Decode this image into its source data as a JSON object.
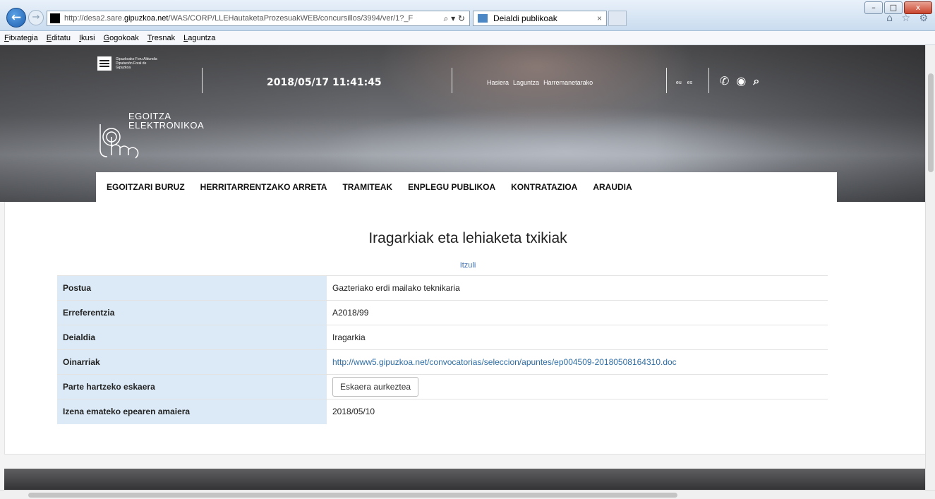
{
  "browser": {
    "url_prefix": "http://desa2.sare.",
    "url_domain": "gipuzkoa.net",
    "url_path": "/WAS/CORP/LLEHautaketaProzesuakWEB/concursillos/3994/ver/1?_F",
    "addr_tools": "⌕ ▾ ↻",
    "tab_title": "Deialdi publikoak",
    "tab_close": "×",
    "right_icons": "⌂ ☆ ⚙",
    "win_minimize": "–",
    "win_maximize": "□",
    "win_close": "x",
    "back": "←",
    "forward": "→"
  },
  "menubar": [
    "Fitxategia",
    "Editatu",
    "Ikusi",
    "Gogokoak",
    "Tresnak",
    "Laguntza"
  ],
  "header": {
    "logo_text": "Gipuzkoako Foru Aldundia Diputación Foral de Gipuzkoa",
    "datetime": "2018/05/17 11:41:45",
    "links": [
      "Hasiera",
      "Laguntza",
      "Harremanetarako"
    ],
    "langs": [
      "eu",
      "es"
    ],
    "icons": [
      "phone-icon",
      "map-pin-icon",
      "search-icon"
    ],
    "icon_glyphs": [
      "✆",
      "◉",
      "⌕"
    ],
    "egoitza_line1": "EGOITZA",
    "egoitza_line2": "ELEKTRONIKOA"
  },
  "nav": [
    "EGOITZARI BURUZ",
    "HERRITARRENTZAKO ARRETA",
    "TRAMITEAK",
    "ENPLEGU PUBLIKOA",
    "KONTRATAZIOA",
    "ARAUDIA"
  ],
  "content": {
    "title": "Iragarkiak eta lehiaketa txikiak",
    "back_link": "Itzuli",
    "rows": [
      {
        "label": "Postua",
        "value": "Gazteriako erdi mailako teknikaria"
      },
      {
        "label": "Erreferentzia",
        "value": "A2018/99"
      },
      {
        "label": "Deialdia",
        "value": "Iragarkia"
      },
      {
        "label": "Oinarriak",
        "value": "http://www5.gipuzkoa.net/convocatorias/seleccion/apuntes/ep004509-20180508164310.doc"
      },
      {
        "label": "Parte hartzeko eskaera",
        "value": "Eskaera aurkeztea"
      },
      {
        "label": "Izena emateko epearen amaiera",
        "value": "2018/05/10"
      }
    ]
  }
}
